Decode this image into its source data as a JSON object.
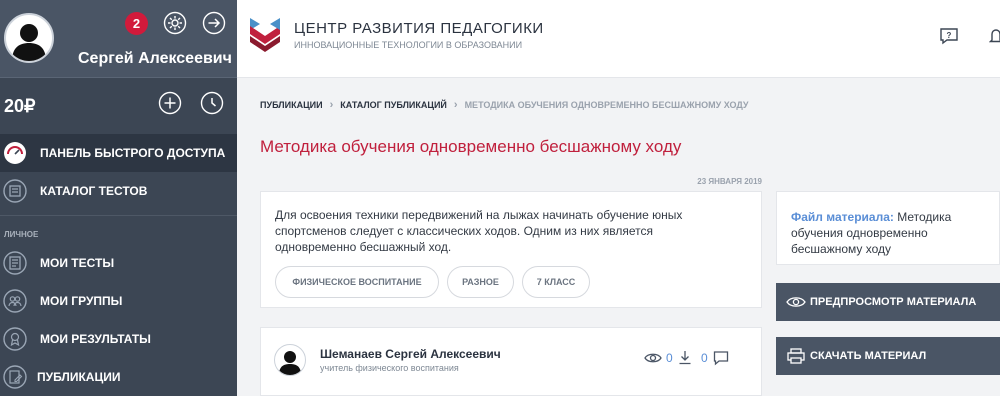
{
  "user": {
    "name": "Сергей Алексеевич",
    "notifications": "2",
    "balance": "20₽"
  },
  "sidebar": {
    "items": [
      {
        "label": "Панель быстрого доступа",
        "active": true
      },
      {
        "label": "Каталог тестов"
      },
      {
        "label": "Мои тесты"
      },
      {
        "label": "Мои группы"
      },
      {
        "label": "Мои результаты"
      },
      {
        "label": "Публикации"
      }
    ],
    "section_label": "Личное"
  },
  "header": {
    "title": "ЦЕНТР РАЗВИТИЯ ПЕДАГОГИКИ",
    "subtitle": "ИННОВАЦИОННЫЕ ТЕХНОЛОГИИ В ОБРАЗОВАНИИ",
    "help_icon_label": "?"
  },
  "breadcrumb": {
    "items": [
      "Публикации",
      "Каталог публикаций",
      "Методика обучения одновременно бесшажному ходу"
    ],
    "separator": "›"
  },
  "page": {
    "title": "Методика обучения одновременно бесшажному ходу",
    "date": "23 января 2019",
    "description": "Для освоения техники передвижений на лыжах начинать обучение юных спортсменов следует с классических ходов. Одним из них является одновременно бесшажный ход.",
    "tags": [
      "Физическое воспитание",
      "Разное",
      "7 класс"
    ]
  },
  "author": {
    "name": "Шеманаев Сергей Алексеевич",
    "role": "учитель физического воспитания",
    "views": "0",
    "downloads": "0",
    "comments": ""
  },
  "file": {
    "label": "Файл материала:",
    "name": "Методика обучения одновременно бесшажному ходу"
  },
  "actions": {
    "preview": "Предпросмотр материала",
    "download": "Скачать материал"
  },
  "colors": {
    "sidebar_bg": "#3c4654",
    "accent_red": "#c0203d",
    "link_blue": "#5a8ed6"
  }
}
